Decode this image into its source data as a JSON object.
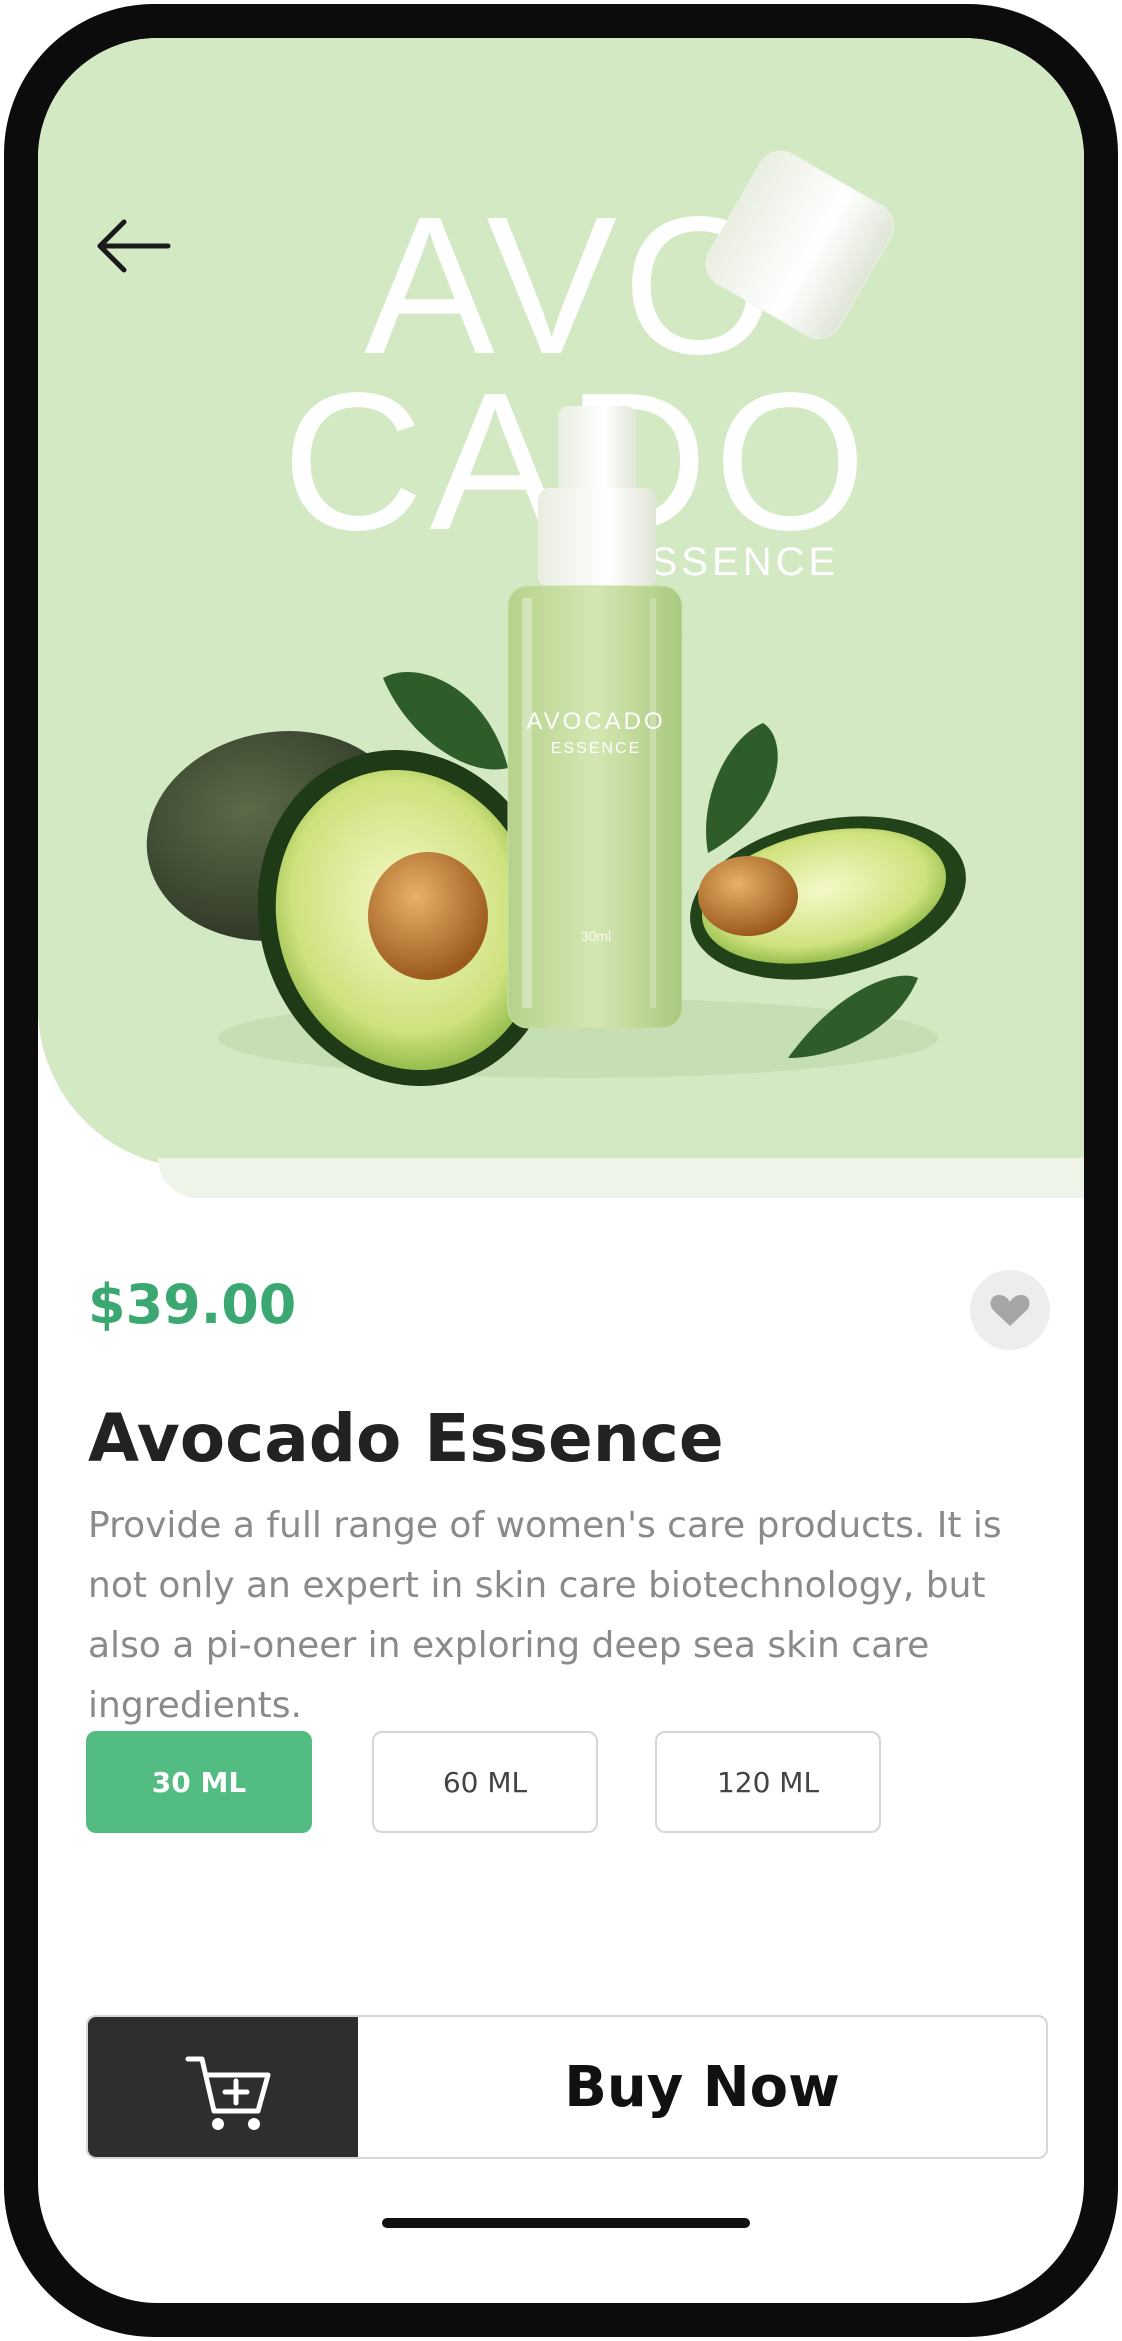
{
  "hero": {
    "word_top": "AVO",
    "word_bottom": "CADO",
    "word_sub": "ESSENCE",
    "bottle_brand": "AVOCADO",
    "bottle_sub": "ESSENCE",
    "bottle_volume": "30ml"
  },
  "product": {
    "price": "$39.00",
    "title": "Avocado  Essence",
    "description": "Provide a full range of women's care products. It is not only an expert in skin care biotechnology, but also a pi-oneer in exploring deep sea skin care ingredients."
  },
  "sizes": [
    {
      "label": "30 ML",
      "selected": true
    },
    {
      "label": "60 ML",
      "selected": false
    },
    {
      "label": "120 ML",
      "selected": false
    }
  ],
  "actions": {
    "buy_label": "Buy Now"
  },
  "icons": {
    "back": "arrow-left-icon",
    "favorite": "heart-icon",
    "cart": "add-to-cart-icon"
  },
  "colors": {
    "hero_bg": "#d3e9c3",
    "accent": "#3ba872",
    "selected_size": "#52bc82",
    "cart_button": "#2e2e2e"
  }
}
